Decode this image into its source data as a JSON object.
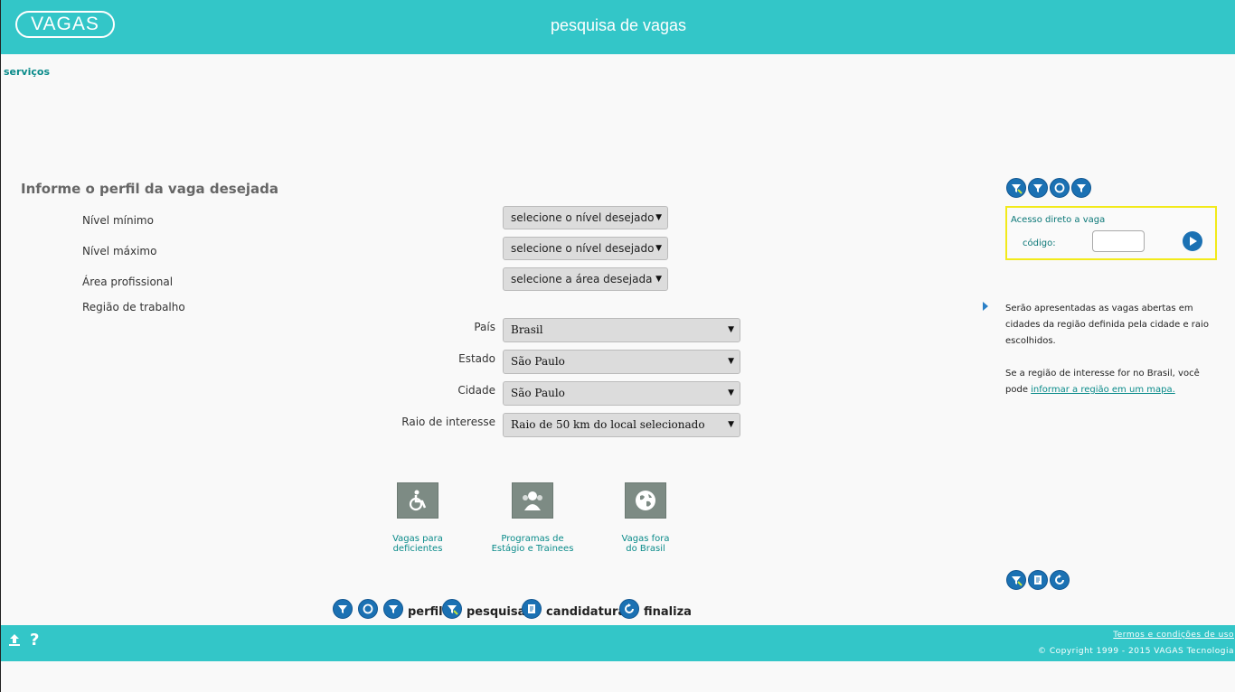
{
  "header": {
    "logo": "VAGAS",
    "title": "pesquisa de vagas"
  },
  "nav": {
    "servicos": "serviços"
  },
  "form": {
    "heading": "Informe o perfil da vaga desejada",
    "nivel_minimo": {
      "label": "Nível mínimo",
      "value": "selecione o nível desejado"
    },
    "nivel_maximo": {
      "label": "Nível máximo",
      "value": "selecione o nível desejado"
    },
    "area": {
      "label": "Área profissional",
      "value": "selecione a área desejada"
    },
    "regiao_label": "Região de trabalho",
    "pais": {
      "label": "País",
      "value": "Brasil"
    },
    "estado": {
      "label": "Estado",
      "value": "São Paulo"
    },
    "cidade": {
      "label": "Cidade",
      "value": "São Paulo"
    },
    "raio": {
      "label": "Raio de interesse",
      "value": "Raio de 50 km do local selecionado"
    }
  },
  "tiles": [
    {
      "label_line1": "Vagas para",
      "label_line2": "deficientes",
      "icon": "wheelchair-icon"
    },
    {
      "label_line1": "Programas de",
      "label_line2": "Estágio e Trainees",
      "icon": "people-icon"
    },
    {
      "label_line1": "Vagas fora",
      "label_line2": "do Brasil",
      "icon": "globe-icon"
    }
  ],
  "steps": {
    "perfil": "perfil",
    "pesquisa": "pesquisa",
    "candidatura": "candidatura",
    "finaliza": "finaliza"
  },
  "direct_access": {
    "title": "Acesso direto a vaga",
    "code_label": "código:",
    "code_value": ""
  },
  "info": {
    "paragraph1": "Serão apresentadas as vagas abertas em cidades da região definida pela cidade e raio escolhidos.",
    "paragraph2_prefix": "Se a região de interesse for no Brasil, você pode ",
    "paragraph2_link": "informar a região em um mapa."
  },
  "footer": {
    "terms": "Termos e condições de uso",
    "copyright": "© Copyright 1999 - 2015 VAGAS Tecnologia"
  },
  "colors": {
    "brand": "#33c6c8",
    "accent_blue": "#1b71b3",
    "link": "#0a8b8a",
    "highlight": "#f2ea1a"
  }
}
